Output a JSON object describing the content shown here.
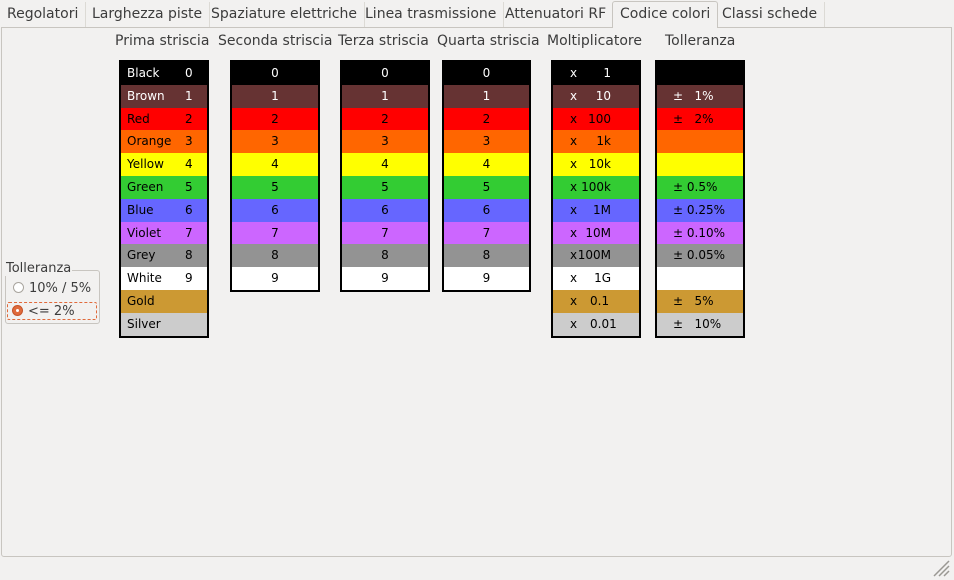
{
  "tabs": [
    {
      "label": "Regolatori",
      "active": false
    },
    {
      "label": "Larghezza piste",
      "active": false
    },
    {
      "label": "Spaziature elettriche",
      "active": false
    },
    {
      "label": "Linea trasmissione",
      "active": false
    },
    {
      "label": "Attenuatori RF",
      "active": false
    },
    {
      "label": "Codice colori",
      "active": true
    },
    {
      "label": "Classi schede",
      "active": false
    }
  ],
  "columns": {
    "first": "Prima striscia",
    "second": "Seconda striscia",
    "third": "Terza striscia",
    "fourth": "Quarta striscia",
    "multiplier": "Moltiplicatore",
    "tolerance": "Tolleranza"
  },
  "colors": [
    {
      "name": "Black",
      "digit": "0",
      "mult": "1",
      "tol": "",
      "bg": "#000000",
      "fg": "#ffffff"
    },
    {
      "name": "Brown",
      "digit": "1",
      "mult": "10",
      "tol": "1%",
      "bg": "#663333",
      "fg": "#ffffff"
    },
    {
      "name": "Red",
      "digit": "2",
      "mult": "100",
      "tol": "2%",
      "bg": "#ff0000",
      "fg": "#000000"
    },
    {
      "name": "Orange",
      "digit": "3",
      "mult": "1k",
      "tol": "",
      "bg": "#ff6600",
      "fg": "#000000"
    },
    {
      "name": "Yellow",
      "digit": "4",
      "mult": "10k",
      "tol": "",
      "bg": "#ffff00",
      "fg": "#000000"
    },
    {
      "name": "Green",
      "digit": "5",
      "mult": "100k",
      "tol": "0.5%",
      "bg": "#33cc33",
      "fg": "#000000"
    },
    {
      "name": "Blue",
      "digit": "6",
      "mult": "1M",
      "tol": "0.25%",
      "bg": "#6666ff",
      "fg": "#000000"
    },
    {
      "name": "Violet",
      "digit": "7",
      "mult": "10M",
      "tol": "0.10%",
      "bg": "#cc66ff",
      "fg": "#000000"
    },
    {
      "name": "Grey",
      "digit": "8",
      "mult": "100M",
      "tol": "0.05%",
      "bg": "#939393",
      "fg": "#000000"
    },
    {
      "name": "White",
      "digit": "9",
      "mult": "1G",
      "tol": "",
      "bg": "#ffffff",
      "fg": "#000000"
    },
    {
      "name": "Gold",
      "digit": "",
      "mult": "0.1",
      "tol": "5%",
      "bg": "#cc9933",
      "fg": "#000000"
    },
    {
      "name": "Silver",
      "digit": "",
      "mult": "0.01",
      "tol": "10%",
      "bg": "#cccccc",
      "fg": "#000000"
    }
  ],
  "symbols": {
    "times": "x",
    "plusminus": "±"
  },
  "tolerance_group": {
    "title": "Tolleranza",
    "options": [
      {
        "label": "10% / 5%",
        "selected": false
      },
      {
        "label": "<= 2%",
        "selected": true
      }
    ]
  }
}
